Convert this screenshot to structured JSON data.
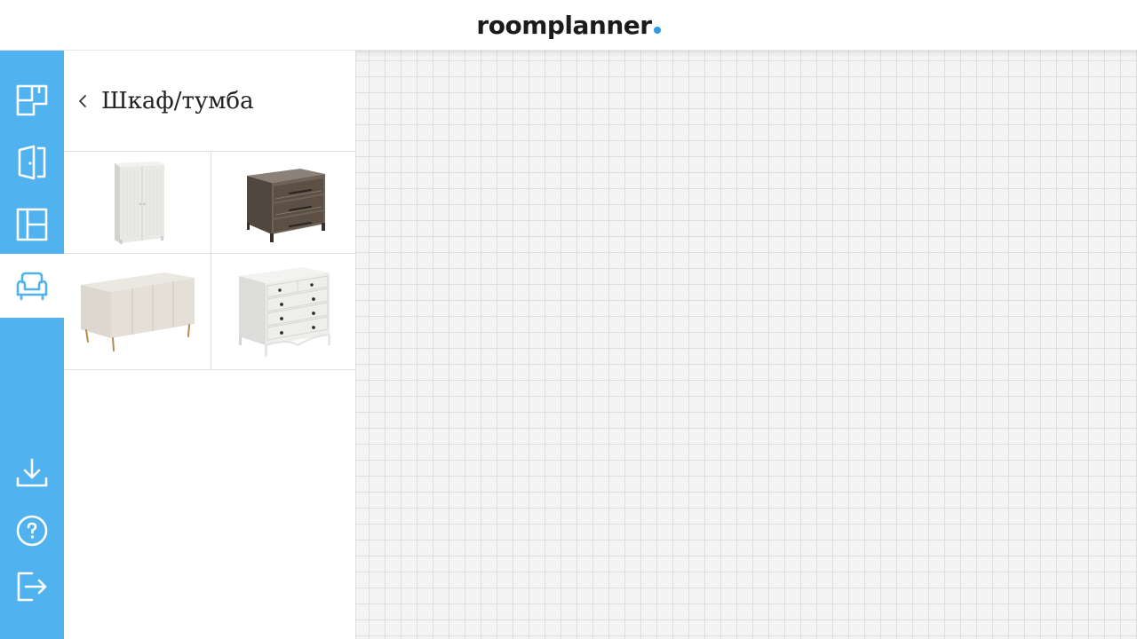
{
  "app": {
    "logo_text": "roomplanner",
    "logo_dot_color": "#2e9be6"
  },
  "colors": {
    "rail_background": "#50b2ef",
    "rail_icon": "#ffffff",
    "active_icon": "#50b2ef",
    "canvas_background": "#f4f4f4",
    "grid_line": "#dedede"
  },
  "rail": {
    "items": [
      {
        "icon": "floorplan-icon",
        "active": false
      },
      {
        "icon": "door-icon",
        "active": false
      },
      {
        "icon": "window-icon",
        "active": false
      },
      {
        "icon": "armchair-icon",
        "active": true
      }
    ],
    "bottom_items": [
      {
        "icon": "download-icon"
      },
      {
        "icon": "help-icon"
      },
      {
        "icon": "logout-icon"
      }
    ]
  },
  "panel": {
    "back_icon": "chevron-left-icon",
    "title": "Шкаф/тумба",
    "items": [
      {
        "kind": "white-wardrobe"
      },
      {
        "kind": "wooden-chest-of-drawers"
      },
      {
        "kind": "beige-sideboard"
      },
      {
        "kind": "white-chest-of-drawers"
      }
    ]
  }
}
